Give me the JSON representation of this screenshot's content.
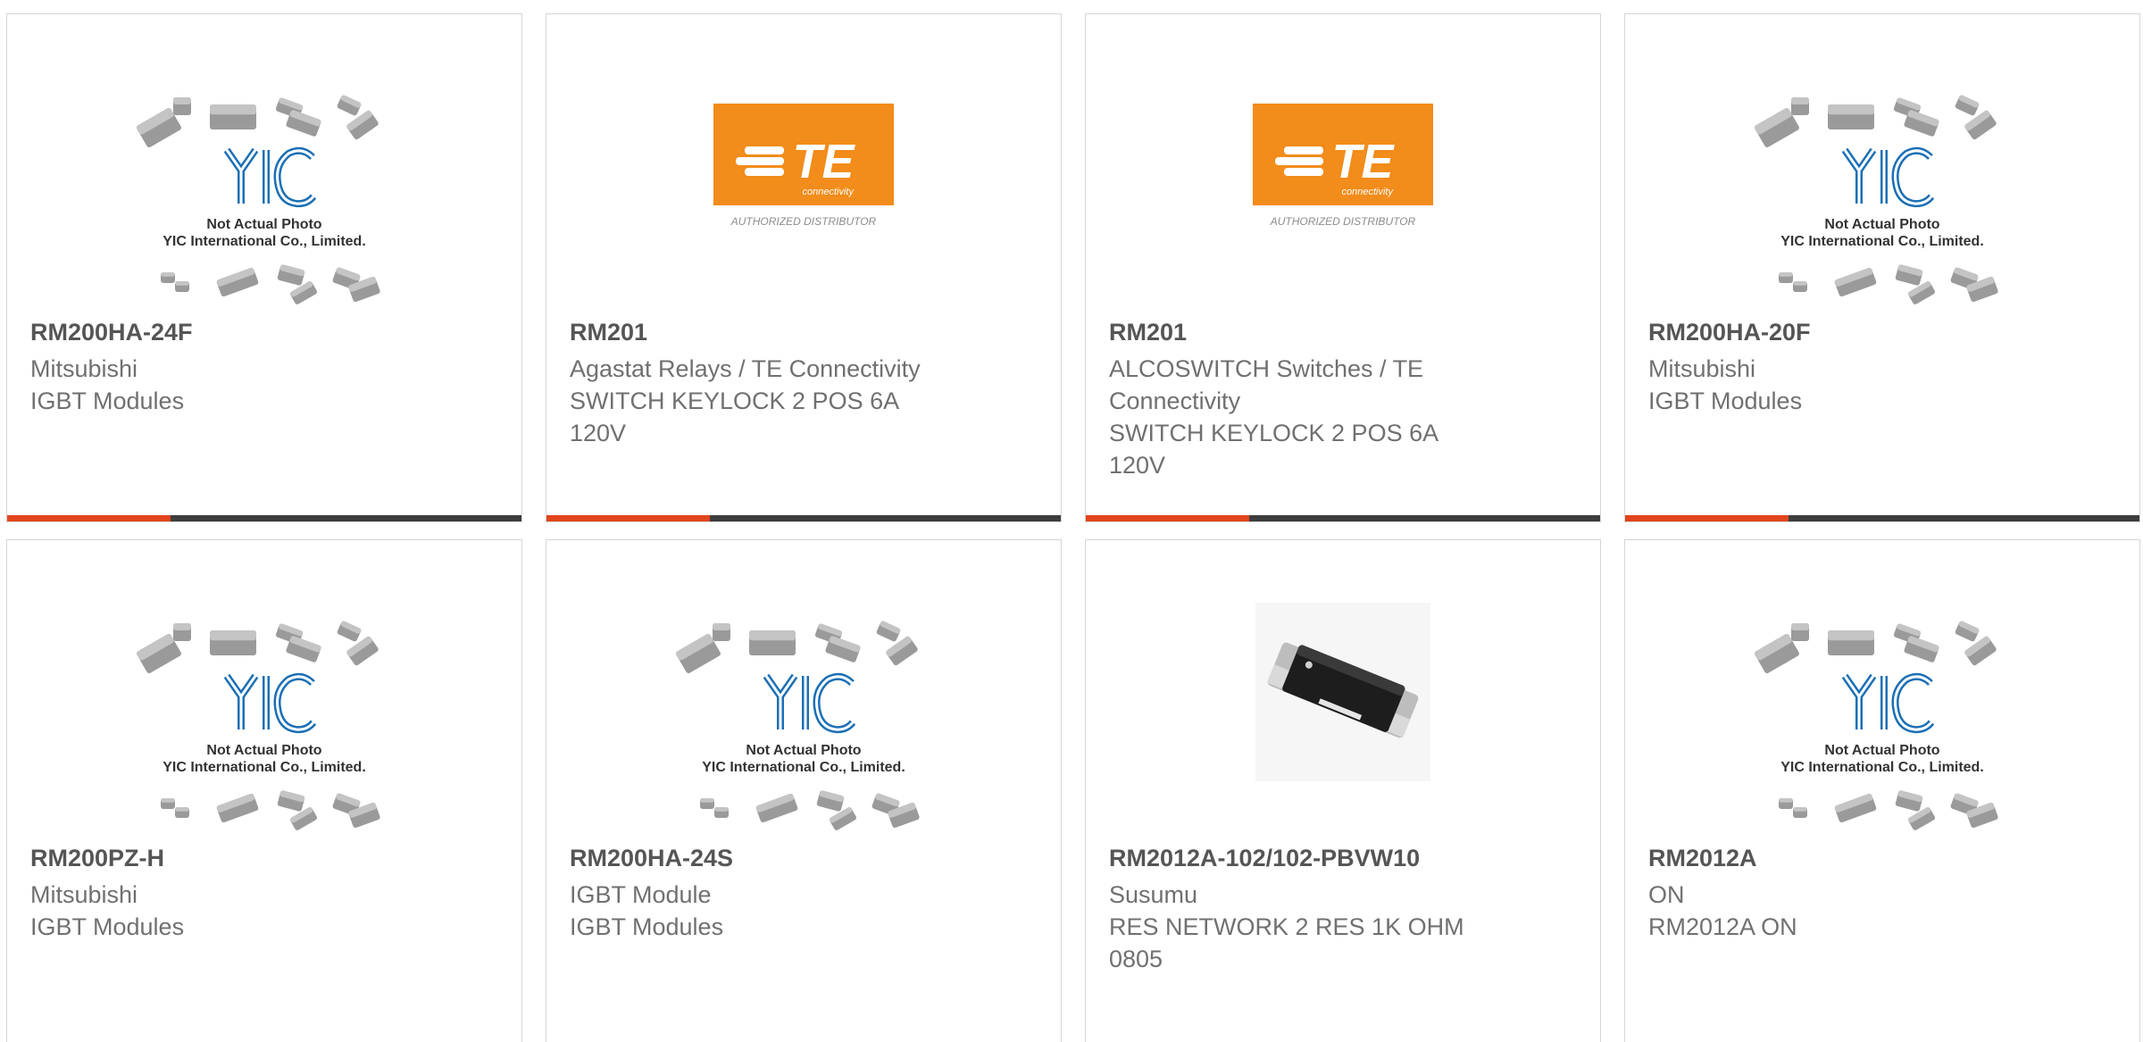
{
  "colors": {
    "accent": "#e2441b",
    "bar": "#3d3d3d",
    "yic_blue": "#1a6fb5",
    "te_orange": "#f28c1a"
  },
  "placeholder_logo": {
    "brand": "YIC",
    "caption_line1": "Not Actual Photo",
    "caption_line2": "YIC International Co., Limited."
  },
  "te_logo": {
    "brand": "TE",
    "sub": "connectivity",
    "caption": "AUTHORIZED DISTRIBUTOR"
  },
  "products": [
    {
      "image": "yic-placeholder",
      "part": "RM200HA-24F",
      "lines": [
        "Mitsubishi",
        "IGBT Modules"
      ]
    },
    {
      "image": "te-logo",
      "part": "RM201",
      "lines": [
        "Agastat Relays / TE Connectivity",
        "SWITCH KEYLOCK 2 POS 6A",
        "120V"
      ]
    },
    {
      "image": "te-logo",
      "part": "RM201",
      "lines": [
        "ALCOSWITCH Switches / TE",
        "Connectivity",
        "SWITCH KEYLOCK 2 POS 6A",
        "120V"
      ]
    },
    {
      "image": "yic-placeholder",
      "part": "RM200HA-20F",
      "lines": [
        "Mitsubishi",
        "IGBT Modules"
      ]
    },
    {
      "image": "yic-placeholder",
      "part": "RM200PZ-H",
      "lines": [
        "Mitsubishi",
        "IGBT Modules"
      ]
    },
    {
      "image": "yic-placeholder",
      "part": "RM200HA-24S",
      "lines": [
        "IGBT Module",
        "IGBT Modules"
      ]
    },
    {
      "image": "resistor-photo",
      "part": "RM2012A-102/102-PBVW10",
      "lines": [
        "Susumu",
        "RES NETWORK 2 RES 1K OHM",
        "0805"
      ]
    },
    {
      "image": "yic-placeholder",
      "part": "RM2012A",
      "lines": [
        "ON",
        "RM2012A ON"
      ]
    }
  ]
}
